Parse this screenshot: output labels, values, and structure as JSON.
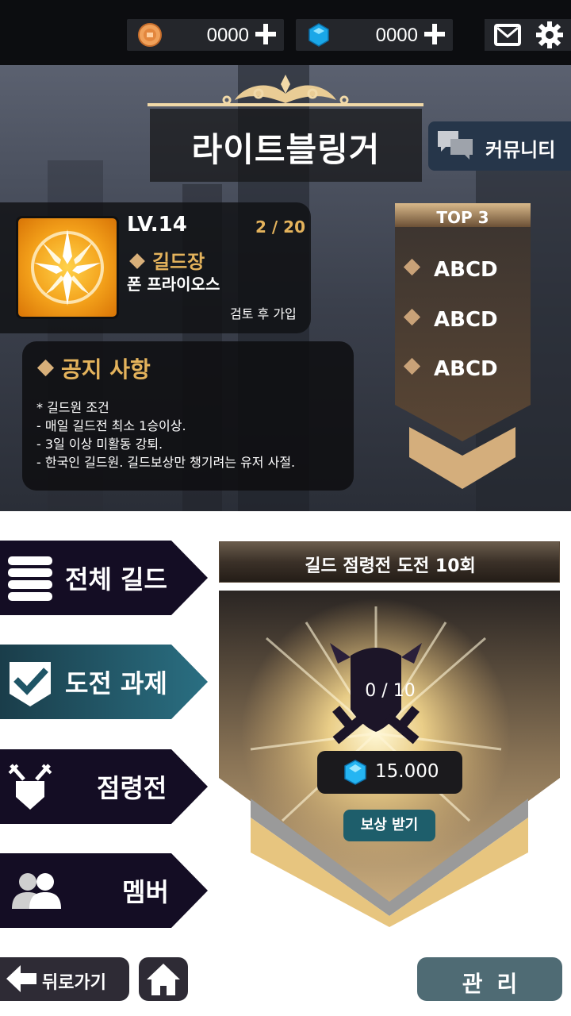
{
  "topbar": {
    "coin_value": "0000",
    "gem_value": "0000",
    "icons": [
      "coin-icon",
      "gem-icon",
      "plus-icon",
      "mail-icon",
      "gear-icon"
    ]
  },
  "guild": {
    "name": "라이트블링거",
    "community_label": "커뮤니티",
    "level": "LV.14",
    "member_count": "2 / 20",
    "rank": "길드장",
    "leader": "폰 프라이오스",
    "join_policy": "검토 후 가입"
  },
  "notice": {
    "title": "공지 사항",
    "lines": [
      "* 길드원 조건",
      "- 매일 길드전 최소 1승이상.",
      "- 3일 이상 미활동 강퇴.",
      "- 한국인 길드원. 길드보상만 챙기려는 유저 사절."
    ]
  },
  "top3": {
    "title": "TOP 3",
    "items": [
      "ABCD",
      "ABCD",
      "ABCD"
    ]
  },
  "menu": {
    "items": [
      {
        "label": "전체 길드",
        "icon": "list-icon"
      },
      {
        "label": "도전 과제",
        "icon": "check-shield-icon"
      },
      {
        "label": "점령전",
        "icon": "crossed-swords-shield-icon"
      },
      {
        "label": "멤버",
        "icon": "members-icon"
      }
    ]
  },
  "challenge": {
    "title": "길드 점령전 도전 10회",
    "progress": "0 / 10",
    "reward_value": "15.000",
    "claim_label": "보상 받기"
  },
  "bottom": {
    "back_label": "뒤로가기",
    "manage_label": "관리"
  },
  "colors": {
    "gold": "#e4b35c",
    "teal": "#1e5e6b",
    "menu_dark": "#140d24",
    "menu_active": "#1f5566"
  }
}
